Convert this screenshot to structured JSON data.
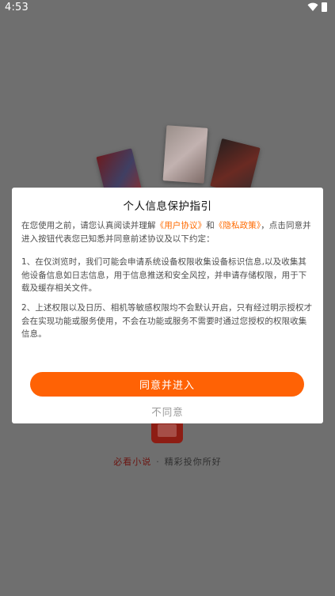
{
  "status_bar": {
    "time": "4:53",
    "icons": [
      "wifi-icon",
      "battery-icon"
    ]
  },
  "splash": {
    "slogan_brand": "必看小说",
    "slogan_dot": "·",
    "slogan_tag": "精彩投你所好"
  },
  "dialog": {
    "title": "个人信息保护指引",
    "p1_prefix": "在您使用之前，请您认真阅读并理解",
    "user_agreement_link": "《用户协议》",
    "and_text": "和",
    "privacy_policy_link": "《隐私政策》",
    "p1_suffix": "，点击同意并进入按钮代表您已知悉并同意前述协议及以下约定：",
    "p2": "1、在仅浏览时，我们可能会申请系统设备权限收集设备标识信息,以及收集其他设备信息如日志信息，用于信息推送和安全风控，并申请存储权限，用于下载及缓存相关文件。",
    "p3": "2、上述权限以及日历、相机等敏感权限均不会默认开启，只有经过明示授权才会在实现功能或服务使用，不会在功能或服务不需要时通过您授权的权限收集信息。",
    "agree_label": "同意并进入",
    "disagree_label": "不同意"
  },
  "colors": {
    "accent": "#ff6205",
    "link": "#ff6a00",
    "overlay": "#6f6f6f"
  }
}
